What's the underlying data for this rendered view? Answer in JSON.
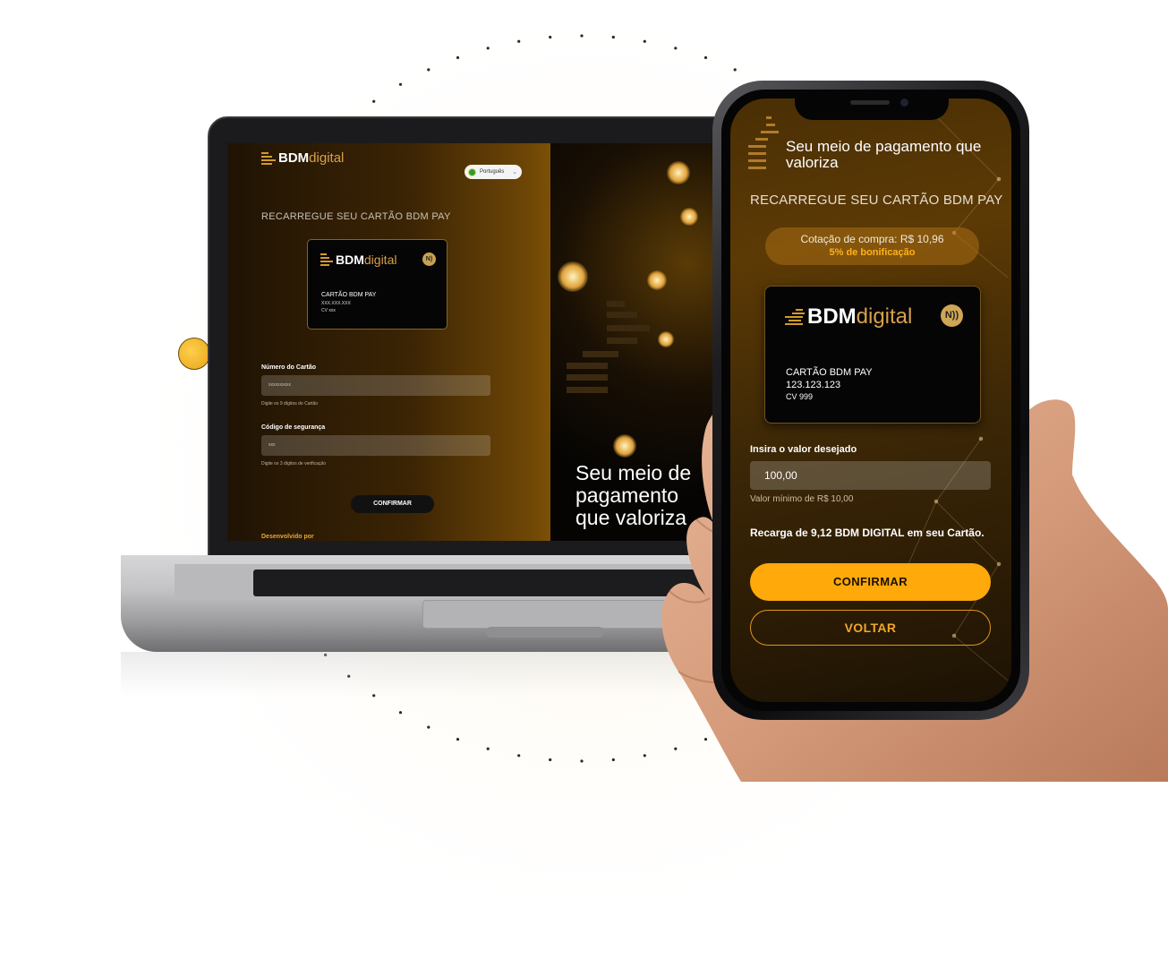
{
  "laptop": {
    "brand": {
      "name_bold": "BDM",
      "name_light": "digital"
    },
    "language": {
      "selected": "Português"
    },
    "title": "RECARREGUE SEU CARTÃO BDM PAY",
    "card": {
      "label": "CARTÃO BDM PAY",
      "number": "XXX.XXX.XXX",
      "cvv": "CV xxx",
      "brand_bold": "BDM",
      "brand_light": "digital"
    },
    "card_number": {
      "label": "Número do Cartão",
      "placeholder": "xxxxxxxxxx",
      "hint": "Digite os 9 dígitos do Cartão"
    },
    "security_code": {
      "label": "Código de segurança",
      "placeholder": "xxx",
      "hint": "Digite os 3 dígitos de verificação"
    },
    "confirm_label": "CONFIRMAR",
    "developed_by": "Desenvolvido por",
    "hero": {
      "line1": "Seu meio de",
      "line2": "pagamento",
      "line3": "que valoriza"
    }
  },
  "phone": {
    "headline": "Seu meio de pagamento que valoriza",
    "title": "RECARREGUE SEU CARTÃO BDM PAY",
    "quote": {
      "rate": "Cotação de compra: R$ 10,96",
      "bonus": "5% de bonificação"
    },
    "card": {
      "brand_bold": "BDM",
      "brand_light": "digital",
      "label": "CARTÃO BDM PAY",
      "number": "123.123.123",
      "cvv": "CV 999",
      "nfc": "N))"
    },
    "amount": {
      "label": "Insira o valor desejado",
      "value": "100,00",
      "minimum": "Valor mínimo de R$ 10,00"
    },
    "recharge_summary": "Recarga de 9,12 BDM DIGITAL em seu Cartão.",
    "confirm_label": "CONFIRMAR",
    "back_label": "VOLTAR"
  },
  "colors": {
    "accent": "#ffa90a",
    "gold": "#d49a2a",
    "dark": "#050505"
  }
}
